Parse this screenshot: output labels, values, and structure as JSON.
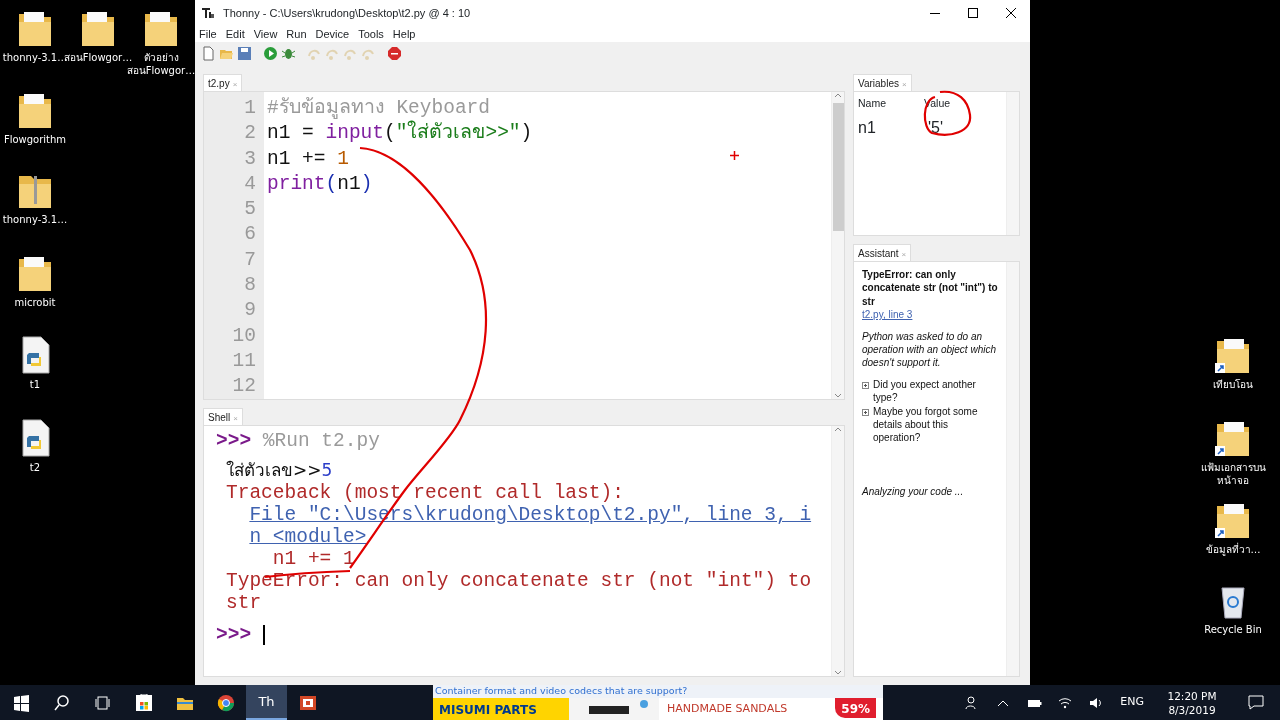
{
  "desktop_left": [
    {
      "label": "thonny-3.1…",
      "kind": "folder"
    },
    {
      "label": "สอนFlowgor…",
      "kind": "folder"
    },
    {
      "label": "ตัวอย่าง สอนFlowgor…",
      "kind": "folder"
    },
    {
      "label": "Flowgorithm",
      "kind": "folder"
    },
    {
      "label": "thonny-3.1…",
      "kind": "zip"
    },
    {
      "label": "microbit",
      "kind": "folder"
    },
    {
      "label": "t1",
      "kind": "python"
    },
    {
      "label": "t2",
      "kind": "python"
    }
  ],
  "desktop_right": [
    {
      "label": "เทียบโอน",
      "kind": "shortcut"
    },
    {
      "label": "แฟ้มเอกสารบนหน้าจอ",
      "kind": "shortcut"
    },
    {
      "label": "ข้อมูลที่วา…",
      "kind": "shortcut"
    },
    {
      "label": "Recycle Bin",
      "kind": "recycle"
    }
  ],
  "window": {
    "title": "Thonny  -  C:\\Users\\krudong\\Desktop\\t2.py  @  4 : 10",
    "menu": [
      "File",
      "Edit",
      "View",
      "Run",
      "Device",
      "Tools",
      "Help"
    ],
    "toolbar": [
      {
        "kind": "new",
        "disabled": false
      },
      {
        "kind": "open",
        "disabled": false
      },
      {
        "kind": "save",
        "disabled": false
      },
      {
        "kind": "run",
        "disabled": false
      },
      {
        "kind": "debug",
        "disabled": false
      },
      {
        "kind": "step",
        "disabled": true
      },
      {
        "kind": "step",
        "disabled": true
      },
      {
        "kind": "step",
        "disabled": true
      },
      {
        "kind": "step",
        "disabled": true
      },
      {
        "kind": "stop",
        "disabled": false
      }
    ],
    "editor_tabs": [
      {
        "label": "t2.py",
        "close_mark": "×",
        "selected": true
      }
    ],
    "editor_lines": [
      {
        "number": "1",
        "tokens": [
          {
            "kind": "comment",
            "text": "#รับข้อมูลทาง Keyboard"
          }
        ]
      },
      {
        "number": "2",
        "tokens": [
          {
            "kind": "plain",
            "text": "n1 = "
          },
          {
            "kind": "builtin",
            "text": "input"
          },
          {
            "kind": "plain",
            "text": "("
          },
          {
            "kind": "string",
            "text": "\"ใส่ตัวเลข>>\""
          },
          {
            "kind": "plain",
            "text": ")"
          }
        ]
      },
      {
        "number": "3",
        "tokens": [
          {
            "kind": "plain",
            "text": "n1 += "
          },
          {
            "kind": "number",
            "text": "1"
          }
        ]
      },
      {
        "number": "4",
        "tokens": [
          {
            "kind": "builtin",
            "text": "print"
          },
          {
            "kind": "paren",
            "text": "("
          },
          {
            "kind": "plain",
            "text": "n1"
          },
          {
            "kind": "paren",
            "text": ")"
          }
        ]
      },
      {
        "number": "5"
      },
      {
        "number": "6"
      },
      {
        "number": "7"
      },
      {
        "number": "8"
      },
      {
        "number": "9"
      },
      {
        "number": "10"
      },
      {
        "number": "11"
      },
      {
        "number": "12"
      }
    ],
    "shell_tabs": [
      {
        "label": "Shell",
        "close_mark": "×",
        "selected": true
      }
    ],
    "shell_lines": [
      {
        "tokens": [
          {
            "kind": "prompt",
            "text": ">>> "
          },
          {
            "kind": "command",
            "text": "%Run t2.py"
          }
        ]
      },
      {
        "tokens": [
          {
            "kind": "stdout",
            "text": "ใส่ตัวเลข>>"
          },
          {
            "kind": "input",
            "text": "5"
          }
        ]
      },
      {
        "tokens": [
          {
            "kind": "error",
            "text": "Traceback (most recent call last):"
          }
        ]
      },
      {
        "indent": true,
        "tokens": [
          {
            "kind": "link",
            "text": "File \"C:\\Users\\krudong\\Desktop\\t2.py\", line 3, in <module>"
          }
        ]
      },
      {
        "tokens": [
          {
            "kind": "error",
            "text": "    n1 += 1"
          }
        ]
      },
      {
        "tokens": [
          {
            "kind": "error",
            "text": "TypeError: can only concatenate str (not \"int\") to str"
          }
        ]
      },
      {
        "tokens": [
          {
            "kind": "prompt",
            "text": ">>> "
          }
        ],
        "cursor": true
      }
    ],
    "variables": {
      "tab": "Variables",
      "tab_close": "×",
      "columns": [
        "Name",
        "Value"
      ],
      "rows": [
        {
          "name": "n1",
          "value": "'5'"
        }
      ]
    },
    "assistant": {
      "tab": "Assistant",
      "tab_close": "×",
      "title": "TypeError: can only concatenate str (not \"int\") to str",
      "link": "t2.py, line 3",
      "explanation": "Python was asked to do an operation with an object which doesn't support it.",
      "hints": [
        {
          "text": "Did you expect another type?"
        },
        {
          "text": "Maybe you forgot some details about this operation?"
        }
      ],
      "status": "Analyzing your code ..."
    }
  },
  "ad": {
    "headline": "Container format and video codecs that are support?",
    "brand": "MISUMI PARTS",
    "offer": "HANDMADE SANDALS",
    "badge": "59%"
  },
  "taskbar": {
    "apps": [
      {
        "kind": "start",
        "selected": false
      },
      {
        "kind": "search",
        "selected": false
      },
      {
        "kind": "taskview",
        "selected": false
      },
      {
        "kind": "store",
        "selected": false
      },
      {
        "kind": "explorer",
        "selected": false
      },
      {
        "kind": "browser",
        "selected": false
      },
      {
        "kind": "thonny",
        "label": "Th",
        "selected": true
      },
      {
        "kind": "slides",
        "selected": false
      }
    ],
    "language": "ENG",
    "time": "12:20 PM",
    "date": "8/3/2019"
  }
}
